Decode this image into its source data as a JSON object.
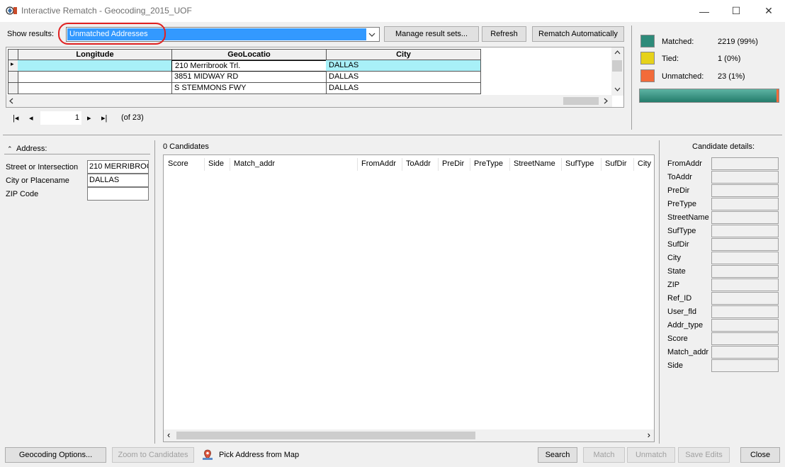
{
  "window": {
    "title": "Interactive Rematch - Geocoding_2015_UOF",
    "minimize_glyph": "—",
    "maximize_glyph": "☐",
    "close_glyph": "✕"
  },
  "toolbar": {
    "show_results_label": "Show results:",
    "show_results_value": "Unmatched Addresses",
    "manage_label": "Manage result sets...",
    "refresh_label": "Refresh",
    "rematch_label": "Rematch Automatically"
  },
  "grid": {
    "columns": [
      "Longitude",
      "GeoLocatio",
      "City"
    ],
    "rows": [
      {
        "longitude": "",
        "geolocation": "210 Merribrook Trl.",
        "city": "DALLAS"
      },
      {
        "longitude": "",
        "geolocation": "3851 MIDWAY RD",
        "city": "DALLAS"
      },
      {
        "longitude": "",
        "geolocation": "S STEMMONS FWY",
        "city": "DALLAS"
      }
    ],
    "current_row_marker": "▸"
  },
  "navigator": {
    "first_glyph": "|◂",
    "prev_glyph": "◂",
    "next_glyph": "▸",
    "last_glyph": "▸|",
    "current": "1",
    "total_text": "(of 23)"
  },
  "stats": {
    "matched_label": "Matched:",
    "matched_value": "2219 (99%)",
    "tied_label": "Tied:",
    "tied_value": "1 (0%)",
    "unmatched_label": "Unmatched:",
    "unmatched_value": "23 (1%)",
    "matched_color": "#2e8b7a",
    "tied_color": "#e6d21a",
    "unmatched_color": "#f26b3a",
    "matched_fraction": 0.99
  },
  "address": {
    "header": "Address:",
    "collapse_glyph": "⌃",
    "fields": [
      {
        "label": "Street or Intersection",
        "value": "210 MERRIBROO"
      },
      {
        "label": "City or Placename",
        "value": "DALLAS"
      },
      {
        "label": "ZIP Code",
        "value": ""
      }
    ]
  },
  "candidates": {
    "count_text": "0 Candidates",
    "columns": [
      "Score",
      "Side",
      "Match_addr",
      "FromAddr",
      "ToAddr",
      "PreDir",
      "PreType",
      "StreetName",
      "SufType",
      "SufDir",
      "City"
    ],
    "scroll_left": "‹",
    "scroll_right": "›"
  },
  "details": {
    "header": "Candidate details:",
    "fields": [
      "FromAddr",
      "ToAddr",
      "PreDir",
      "PreType",
      "StreetName",
      "SufType",
      "SufDir",
      "City",
      "State",
      "ZIP",
      "Ref_ID",
      "User_fld",
      "Addr_type",
      "Score",
      "Match_addr",
      "Side"
    ]
  },
  "bottom": {
    "geocoding_options": "Geocoding Options...",
    "zoom_to_candidates": "Zoom to Candidates",
    "pick_address": "Pick Address from Map",
    "search": "Search",
    "match": "Match",
    "unmatch": "Unmatch",
    "save_edits": "Save Edits",
    "close": "Close"
  }
}
